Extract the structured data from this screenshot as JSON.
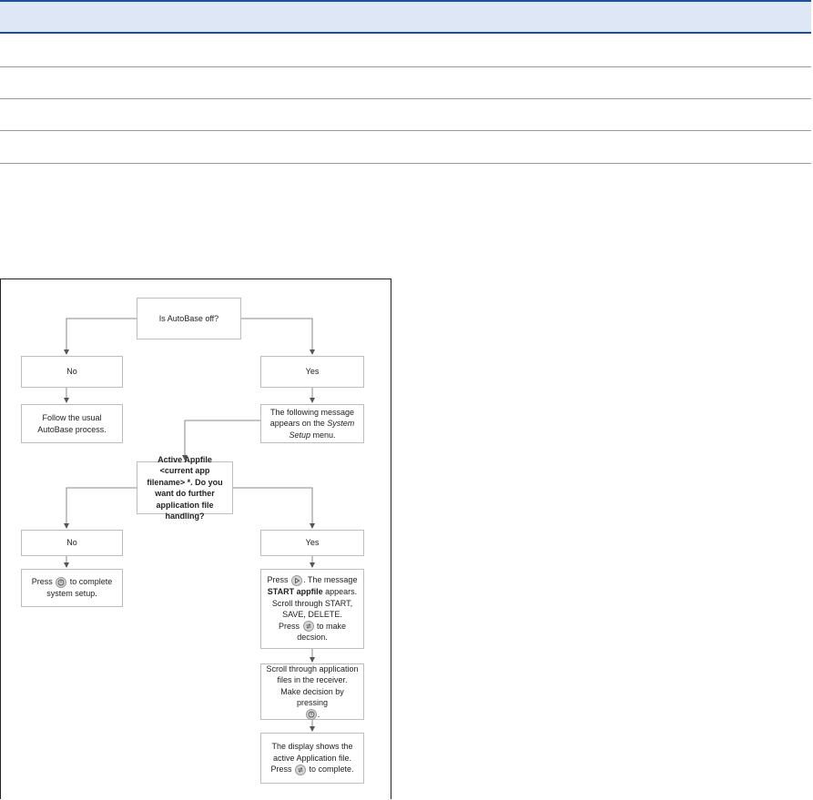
{
  "table": {
    "header": "",
    "rows": [
      "",
      "",
      "",
      ""
    ]
  },
  "flowchart": {
    "start": "Is AutoBase off?",
    "no_1": "No",
    "yes_1": "Yes",
    "follow_usual": "Follow the usual AutoBase process.",
    "message_line1": "The following message appears on the",
    "message_menu": "System Setup",
    "message_line2": "menu.",
    "question": "Active Appfile <current app filename> *. Do you want do further application file handling?",
    "no_2": "No",
    "yes_2": "Yes",
    "press_complete_pre": "Press",
    "press_complete_post": "to complete system setup.",
    "press_play_pre": "Press",
    "press_play_post": ". The message",
    "start_appfile": "START appfile",
    "appears": "appears.",
    "scroll_options": "Scroll through START, SAVE, DELETE.",
    "make_decision_pre": "Press",
    "make_decision_post": "to make decsion.",
    "scroll_files": "Scroll through application files in the receiver.",
    "decision_pressing": "Make decision by pressing",
    "period": ".",
    "display_shows": "The display shows the active Application file.",
    "press_to_complete_pre": "Press",
    "press_to_complete_post": "to complete."
  },
  "icons": [
    "power-button-icon",
    "play-button-icon",
    "scroll-button-icon"
  ]
}
